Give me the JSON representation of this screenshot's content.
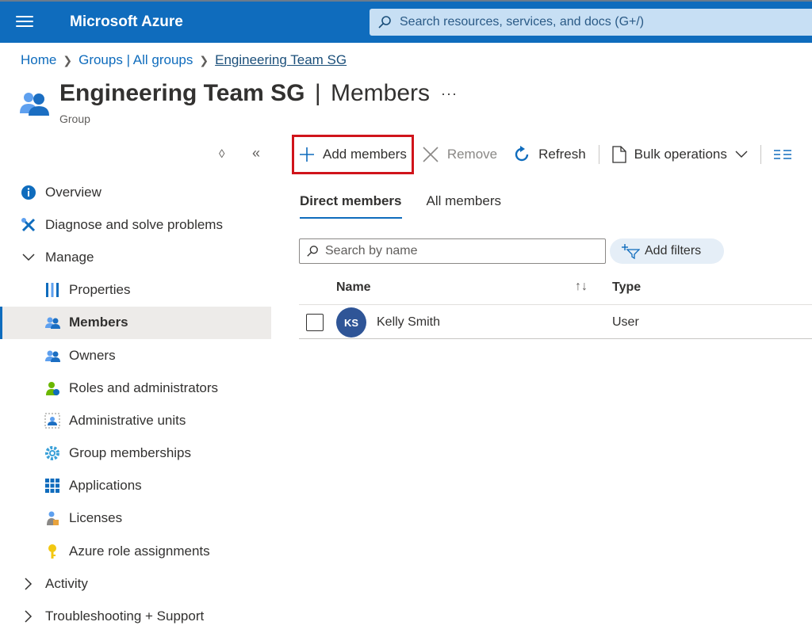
{
  "topbar": {
    "brand": "Microsoft Azure",
    "search_placeholder": "Search resources, services, and docs (G+/)"
  },
  "breadcrumb": [
    "Home",
    "Groups | All groups",
    "Engineering Team SG"
  ],
  "header": {
    "title_name": "Engineering Team SG",
    "title_separator": "|",
    "title_page": "Members",
    "more": "···",
    "subtitle": "Group"
  },
  "sidebar": {
    "collapse_glyph": "«",
    "expand_glyph": "◊",
    "items": [
      {
        "label": "Overview",
        "icon": "info-icon"
      },
      {
        "label": "Diagnose and solve problems",
        "icon": "wrench-icon"
      },
      {
        "label": "Manage",
        "icon": "chevron-down-icon"
      },
      {
        "label": "Properties",
        "icon": "properties-icon"
      },
      {
        "label": "Members",
        "icon": "members-icon",
        "active": true
      },
      {
        "label": "Owners",
        "icon": "owners-icon"
      },
      {
        "label": "Roles and administrators",
        "icon": "roles-icon"
      },
      {
        "label": "Administrative units",
        "icon": "admin-units-icon"
      },
      {
        "label": "Group memberships",
        "icon": "gear-icon"
      },
      {
        "label": "Applications",
        "icon": "apps-grid-icon"
      },
      {
        "label": "Licenses",
        "icon": "licenses-icon"
      },
      {
        "label": "Azure role assignments",
        "icon": "key-icon"
      },
      {
        "label": "Activity",
        "icon": "chevron-right-icon"
      },
      {
        "label": "Troubleshooting + Support",
        "icon": "chevron-right-icon"
      }
    ]
  },
  "commands": {
    "add_members": "Add members",
    "remove": "Remove",
    "refresh": "Refresh",
    "bulk_operations": "Bulk operations"
  },
  "tabs": [
    "Direct members",
    "All members"
  ],
  "member_search": {
    "placeholder": "Search by name"
  },
  "filters": {
    "label": "Add filters"
  },
  "table": {
    "columns": {
      "name": "Name",
      "type": "Type",
      "sort_glyph": "↑↓"
    },
    "rows": [
      {
        "initials": "KS",
        "name": "Kelly Smith",
        "type": "User"
      }
    ]
  },
  "colors": {
    "topbar": "#0f6cbd",
    "accent": "#0f6cbd",
    "highlight_box": "#d0141b",
    "avatar": "#2f5597"
  }
}
